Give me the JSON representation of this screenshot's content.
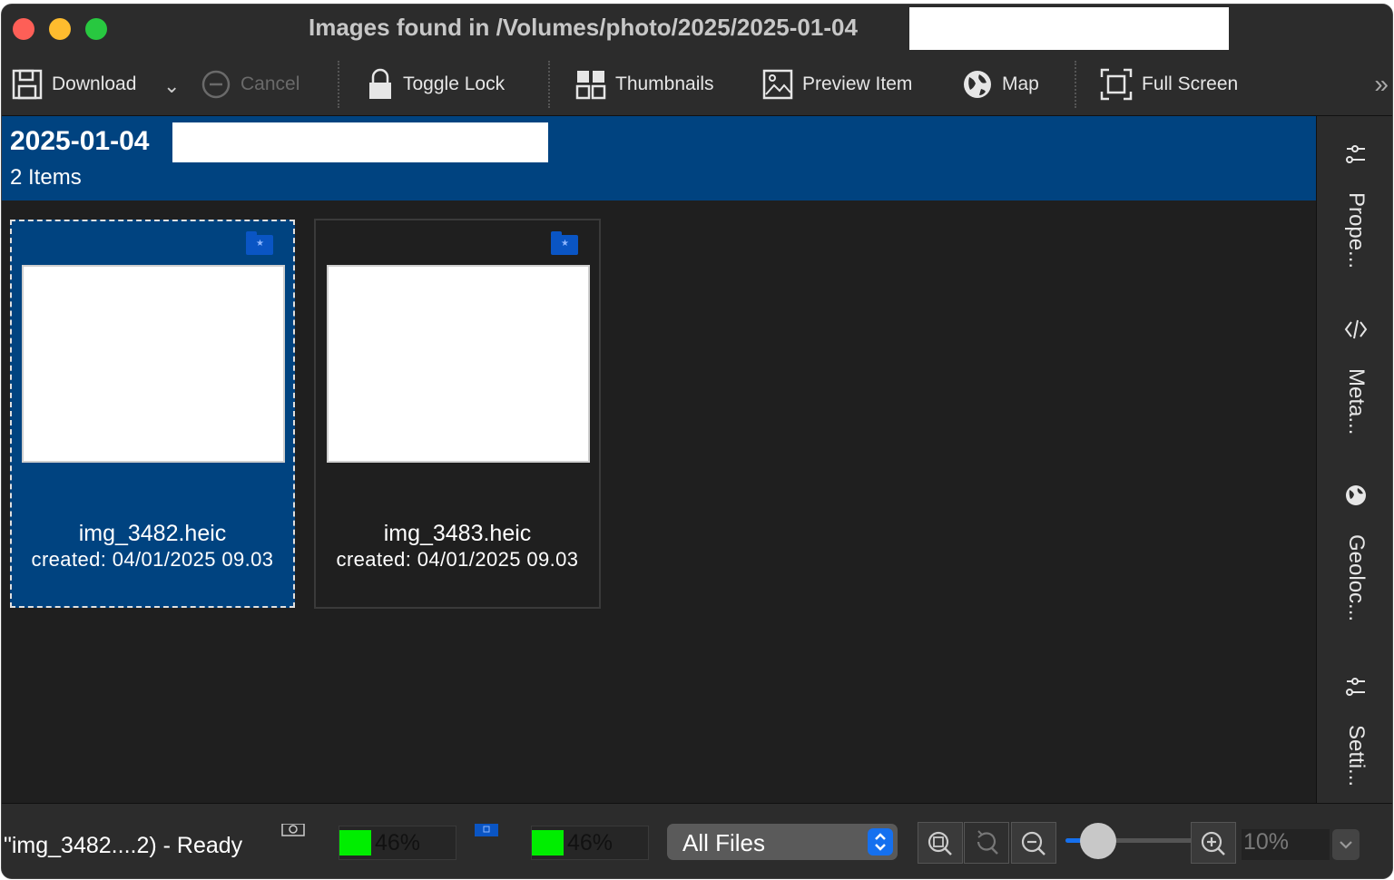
{
  "window": {
    "title": "Images found in /Volumes/photo/2025/2025-01-04"
  },
  "toolbar": {
    "download_label": "Download",
    "download_dropdown_glyph": "⌄",
    "cancel_label": "Cancel",
    "toggle_lock_label": "Toggle Lock",
    "thumbnails_label": "Thumbnails",
    "preview_item_label": "Preview Item",
    "map_label": "Map",
    "full_screen_label": "Full Screen",
    "overflow_glyph": "»"
  },
  "header": {
    "folder_name": "2025-01-04",
    "item_count": "2 Items"
  },
  "items": [
    {
      "name": "img_3482.heic",
      "created": "created: 04/01/2025 09.03",
      "selected": true
    },
    {
      "name": "img_3483.heic",
      "created": "created: 04/01/2025 09.03",
      "selected": false
    }
  ],
  "sidebar": {
    "items": [
      {
        "label": "Prope...",
        "icon": "sliders-icon"
      },
      {
        "label": "Meta...",
        "icon": "code-icon"
      },
      {
        "label": "Geoloc...",
        "icon": "globe-icon"
      },
      {
        "label": "Setti...",
        "icon": "sliders-icon"
      }
    ]
  },
  "statusbar": {
    "status_text": "\"img_3482....2) - Ready",
    "progress": [
      {
        "value": 46,
        "label": "46%",
        "icon": "camera-icon"
      },
      {
        "value": 46,
        "label": "46%",
        "icon": "disk-icon"
      }
    ],
    "filter": {
      "selected": "All Files"
    },
    "zoom": {
      "value": "10%",
      "slider_fraction": 0.1
    }
  },
  "colors": {
    "accent": "#004380",
    "toolbar_bg": "#2c2c2c",
    "content_bg": "#1f1f1f",
    "progress_fill": "#00ee00",
    "control_blue": "#1570ef"
  }
}
